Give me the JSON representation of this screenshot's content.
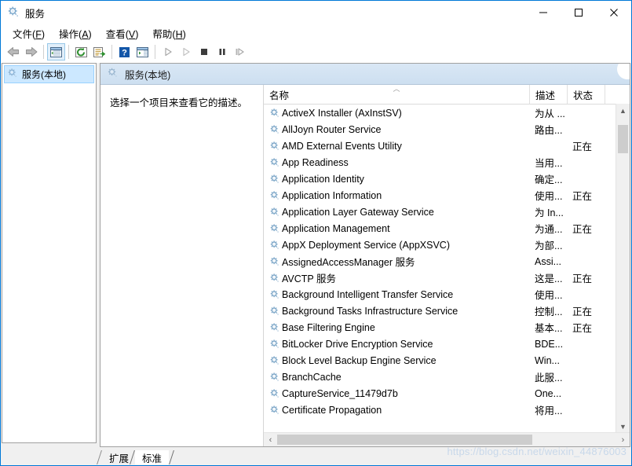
{
  "window": {
    "title": "服务",
    "icon": "gear-icon",
    "minimize_label": "—",
    "maximize_label": "▭",
    "close_label": "✕"
  },
  "menubar": {
    "items": [
      {
        "label": "文件",
        "accel": "F"
      },
      {
        "label": "操作",
        "accel": "A"
      },
      {
        "label": "查看",
        "accel": "V"
      },
      {
        "label": "帮助",
        "accel": "H"
      }
    ]
  },
  "toolbar": {
    "buttons": [
      {
        "name": "back-arrow-icon",
        "enabled": true
      },
      {
        "name": "forward-arrow-icon",
        "enabled": true
      },
      {
        "name": "show-hide-tree-icon",
        "enabled": true,
        "active": true
      },
      {
        "name": "refresh-icon",
        "enabled": true
      },
      {
        "name": "export-list-icon",
        "enabled": true
      },
      {
        "name": "help-icon",
        "enabled": true
      },
      {
        "name": "show-action-pane-icon",
        "enabled": true
      },
      {
        "name": "start-service-icon",
        "enabled": false
      },
      {
        "name": "resume-service-icon",
        "enabled": false
      },
      {
        "name": "stop-service-icon",
        "enabled": true
      },
      {
        "name": "pause-service-icon",
        "enabled": true
      },
      {
        "name": "restart-service-icon",
        "enabled": false
      }
    ]
  },
  "tree": {
    "nodes": [
      {
        "label": "服务(本地)",
        "icon": "gear-icon",
        "selected": true
      }
    ]
  },
  "panel": {
    "header_title": "服务(本地)",
    "header_icon": "gear-icon",
    "description_placeholder": "选择一个项目来查看它的描述。"
  },
  "list": {
    "columns": [
      {
        "key": "name",
        "label": "名称",
        "sorted": "asc",
        "sort_glyph": "︿"
      },
      {
        "key": "description",
        "label": "描述"
      },
      {
        "key": "status",
        "label": "状态"
      },
      {
        "key": "startup",
        "label": ""
      }
    ],
    "rows": [
      {
        "name": "ActiveX Installer (AxInstSV)",
        "description": "为从 ...",
        "status": ""
      },
      {
        "name": "AllJoyn Router Service",
        "description": "路由...",
        "status": ""
      },
      {
        "name": "AMD External Events Utility",
        "description": "",
        "status": "正在"
      },
      {
        "name": "App Readiness",
        "description": "当用...",
        "status": ""
      },
      {
        "name": "Application Identity",
        "description": "确定...",
        "status": ""
      },
      {
        "name": "Application Information",
        "description": "使用...",
        "status": "正在"
      },
      {
        "name": "Application Layer Gateway Service",
        "description": "为 In...",
        "status": ""
      },
      {
        "name": "Application Management",
        "description": "为通...",
        "status": "正在"
      },
      {
        "name": "AppX Deployment Service (AppXSVC)",
        "description": "为部...",
        "status": ""
      },
      {
        "name": "AssignedAccessManager 服务",
        "description": "Assi...",
        "status": ""
      },
      {
        "name": "AVCTP 服务",
        "description": "这是...",
        "status": "正在"
      },
      {
        "name": "Background Intelligent Transfer Service",
        "description": "使用...",
        "status": ""
      },
      {
        "name": "Background Tasks Infrastructure Service",
        "description": "控制...",
        "status": "正在"
      },
      {
        "name": "Base Filtering Engine",
        "description": "基本...",
        "status": "正在"
      },
      {
        "name": "BitLocker Drive Encryption Service",
        "description": "BDE...",
        "status": ""
      },
      {
        "name": "Block Level Backup Engine Service",
        "description": "Win...",
        "status": ""
      },
      {
        "name": "BranchCache",
        "description": "此服...",
        "status": ""
      },
      {
        "name": "CaptureService_11479d7b",
        "description": "One...",
        "status": ""
      },
      {
        "name": "Certificate Propagation",
        "description": "将用...",
        "status": ""
      }
    ]
  },
  "tabs": [
    {
      "label": "扩展",
      "selected": false
    },
    {
      "label": "标准",
      "selected": true
    }
  ],
  "watermark": "https://blog.csdn.net/weixin_44876003",
  "colors": {
    "window_border": "#0078d7",
    "panel_header_top": "#d9e7f5",
    "tree_selection": "#cce8ff",
    "toolbar_active": "#e2effa",
    "watermark": "#c8d8ea"
  }
}
